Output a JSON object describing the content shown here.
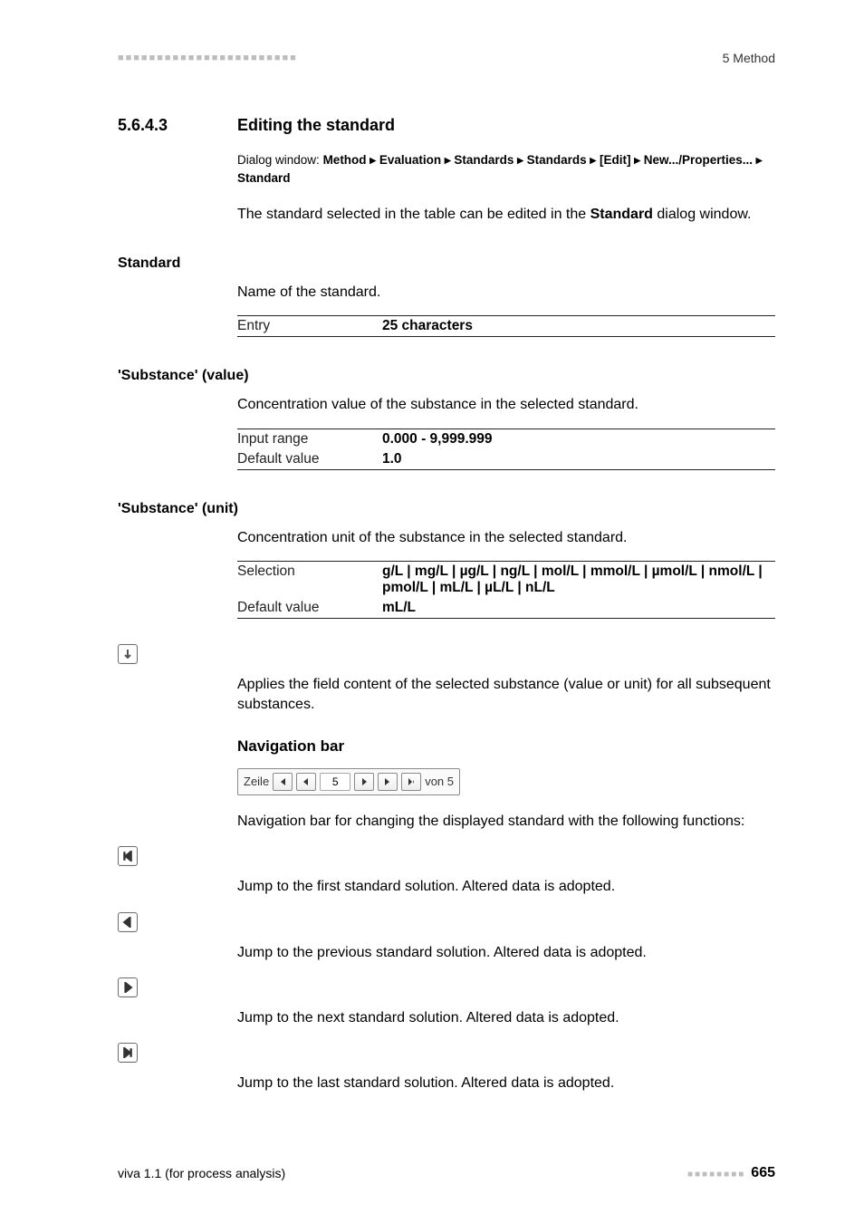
{
  "header": {
    "left_dashes": "■■■■■■■■■■■■■■■■■■■■■■■",
    "right": "5 Method"
  },
  "section": {
    "number": "5.6.4.3",
    "title": "Editing the standard"
  },
  "dialog": {
    "prefix": "Dialog window:",
    "path": "Method ▸ Evaluation ▸ Standards ▸ Standards ▸ [Edit] ▸ New.../Properties... ▸ Standard"
  },
  "intro": {
    "pre": "The standard selected in the table can be edited in the ",
    "bold": "Standard",
    "post": " dialog window."
  },
  "fields": {
    "standard": {
      "label": "Standard",
      "desc": "Name of the standard.",
      "rows": [
        {
          "k": "Entry",
          "v": "25 characters"
        }
      ]
    },
    "sub_value": {
      "label": "'Substance' (value)",
      "desc": "Concentration value of the substance in the selected standard.",
      "rows": [
        {
          "k": "Input range",
          "v": "0.000 - 9,999.999"
        },
        {
          "k": "Default value",
          "v": "1.0"
        }
      ]
    },
    "sub_unit": {
      "label": "'Substance' (unit)",
      "desc": "Concentration unit of the substance in the selected standard.",
      "rows": [
        {
          "k": "Selection",
          "v": "g/L | mg/L | µg/L | ng/L | mol/L | mmol/L | µmol/L | nmol/L | pmol/L | mL/L | µL/L | nL/L"
        },
        {
          "k": "Default value",
          "v": "mL/L"
        }
      ]
    }
  },
  "apply_down": {
    "icon": "arrow-down-icon",
    "text": "Applies the field content of the selected substance (value or unit) for all subsequent substances."
  },
  "navbar": {
    "heading": "Navigation bar",
    "label_left": "Zeile",
    "value": "5",
    "label_right": "von 5",
    "desc": "Navigation bar for changing the displayed standard with the following functions:"
  },
  "nav_items": [
    {
      "icon": "nav-first-icon",
      "text": "Jump to the first standard solution. Altered data is adopted."
    },
    {
      "icon": "nav-prev-icon",
      "text": "Jump to the previous standard solution. Altered data is adopted."
    },
    {
      "icon": "nav-next-icon",
      "text": "Jump to the next standard solution. Altered data is adopted."
    },
    {
      "icon": "nav-last-icon",
      "text": "Jump to the last standard solution. Altered data is adopted."
    }
  ],
  "footer": {
    "left": "viva 1.1 (for process analysis)",
    "dashes": "■■■■■■■■",
    "page": "665"
  }
}
